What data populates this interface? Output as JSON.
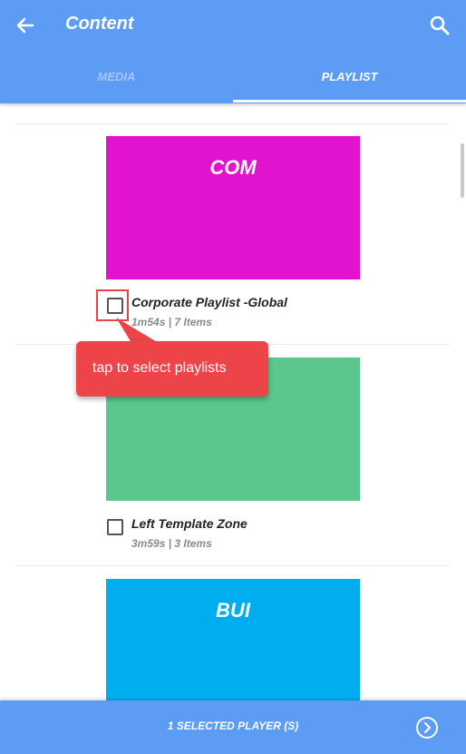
{
  "header": {
    "title": "Content",
    "back_icon": "arrow-left-icon",
    "search_icon": "search-icon"
  },
  "tabs": [
    {
      "label": "MEDIA",
      "active": false
    },
    {
      "label": "PLAYLIST",
      "active": true
    }
  ],
  "playlists": [
    {
      "thumb_text": "COM",
      "thumb_color": "#e113cf",
      "name": "Corporate Playlist -Global",
      "meta": "1m54s | 7 Items",
      "checked": false
    },
    {
      "thumb_text": "",
      "thumb_color": "#5bc78d",
      "name": "Left Template Zone",
      "meta": "3m59s | 3 Items",
      "checked": false
    },
    {
      "thumb_text": "BUI",
      "thumb_color": "#00aeef"
    }
  ],
  "callout": {
    "text": "tap to select playlists",
    "color": "#ec4448"
  },
  "footer": {
    "selected_label": "1 SELECTED PLAYER (S)",
    "next_icon": "chevron-right-circle-icon"
  },
  "colors": {
    "accent": "#5c9cf5",
    "tab_inactive": "#a7c6f6"
  }
}
